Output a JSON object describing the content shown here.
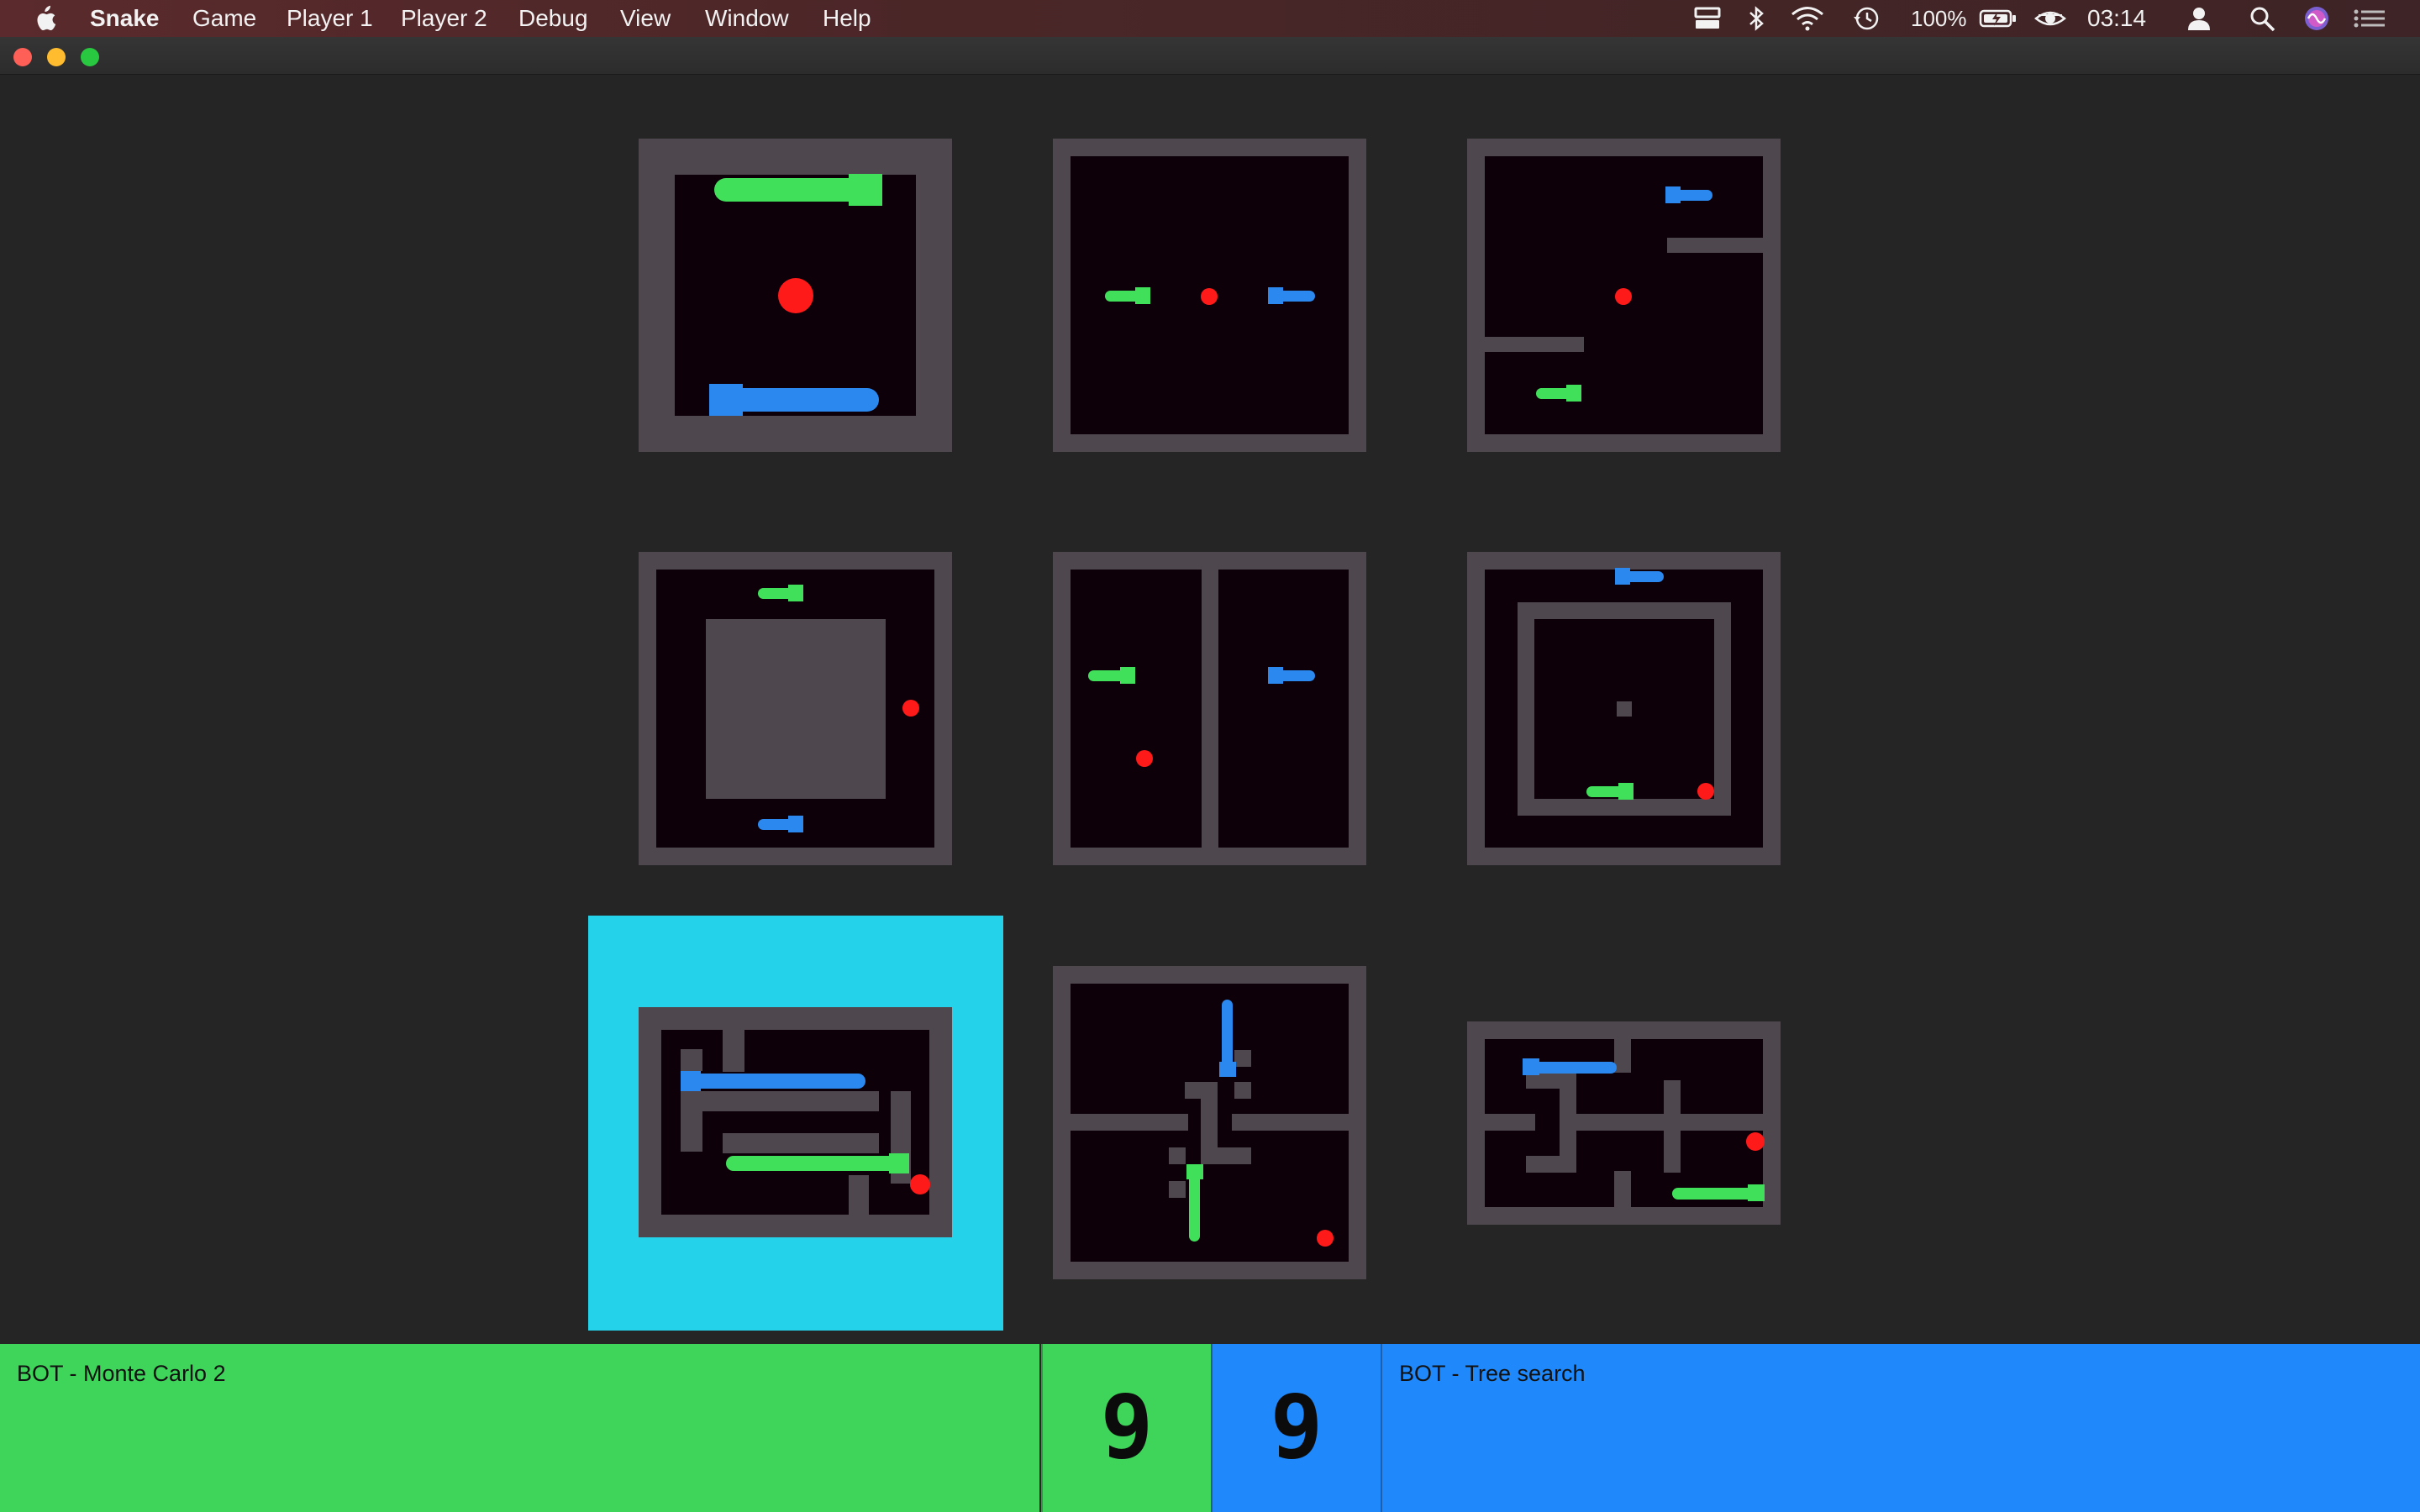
{
  "menubar": {
    "app_name": "Snake",
    "items": [
      "Game",
      "Player 1",
      "Player 2",
      "Debug",
      "View",
      "Window",
      "Help"
    ],
    "battery": "100%",
    "clock": "03:14",
    "icons": [
      "apple-icon",
      "display-icon",
      "bluetooth-icon",
      "wifi-icon",
      "time-machine-icon",
      "battery-icon",
      "eye-icon",
      "user-icon",
      "search-icon",
      "siri-icon",
      "notification-center-icon"
    ]
  },
  "window": {
    "traffic_lights": {
      "close": "#fe5f57",
      "minimize": "#febc2e",
      "zoom": "#28c840"
    }
  },
  "game": {
    "board_count": 9,
    "selected_board": 7,
    "colors": {
      "player1": "#41e05a",
      "player2": "#2a88ef",
      "food": "#ff1a1a",
      "wall": "#4e474e",
      "floor": "#0e0008",
      "selection": "#24d3ea"
    }
  },
  "players": {
    "player1": {
      "name": "BOT - Monte Carlo 2",
      "score": "9",
      "color": "#3fd55a"
    },
    "player2": {
      "name": "BOT - Tree search",
      "score": "9",
      "color": "#1f88fa"
    }
  }
}
